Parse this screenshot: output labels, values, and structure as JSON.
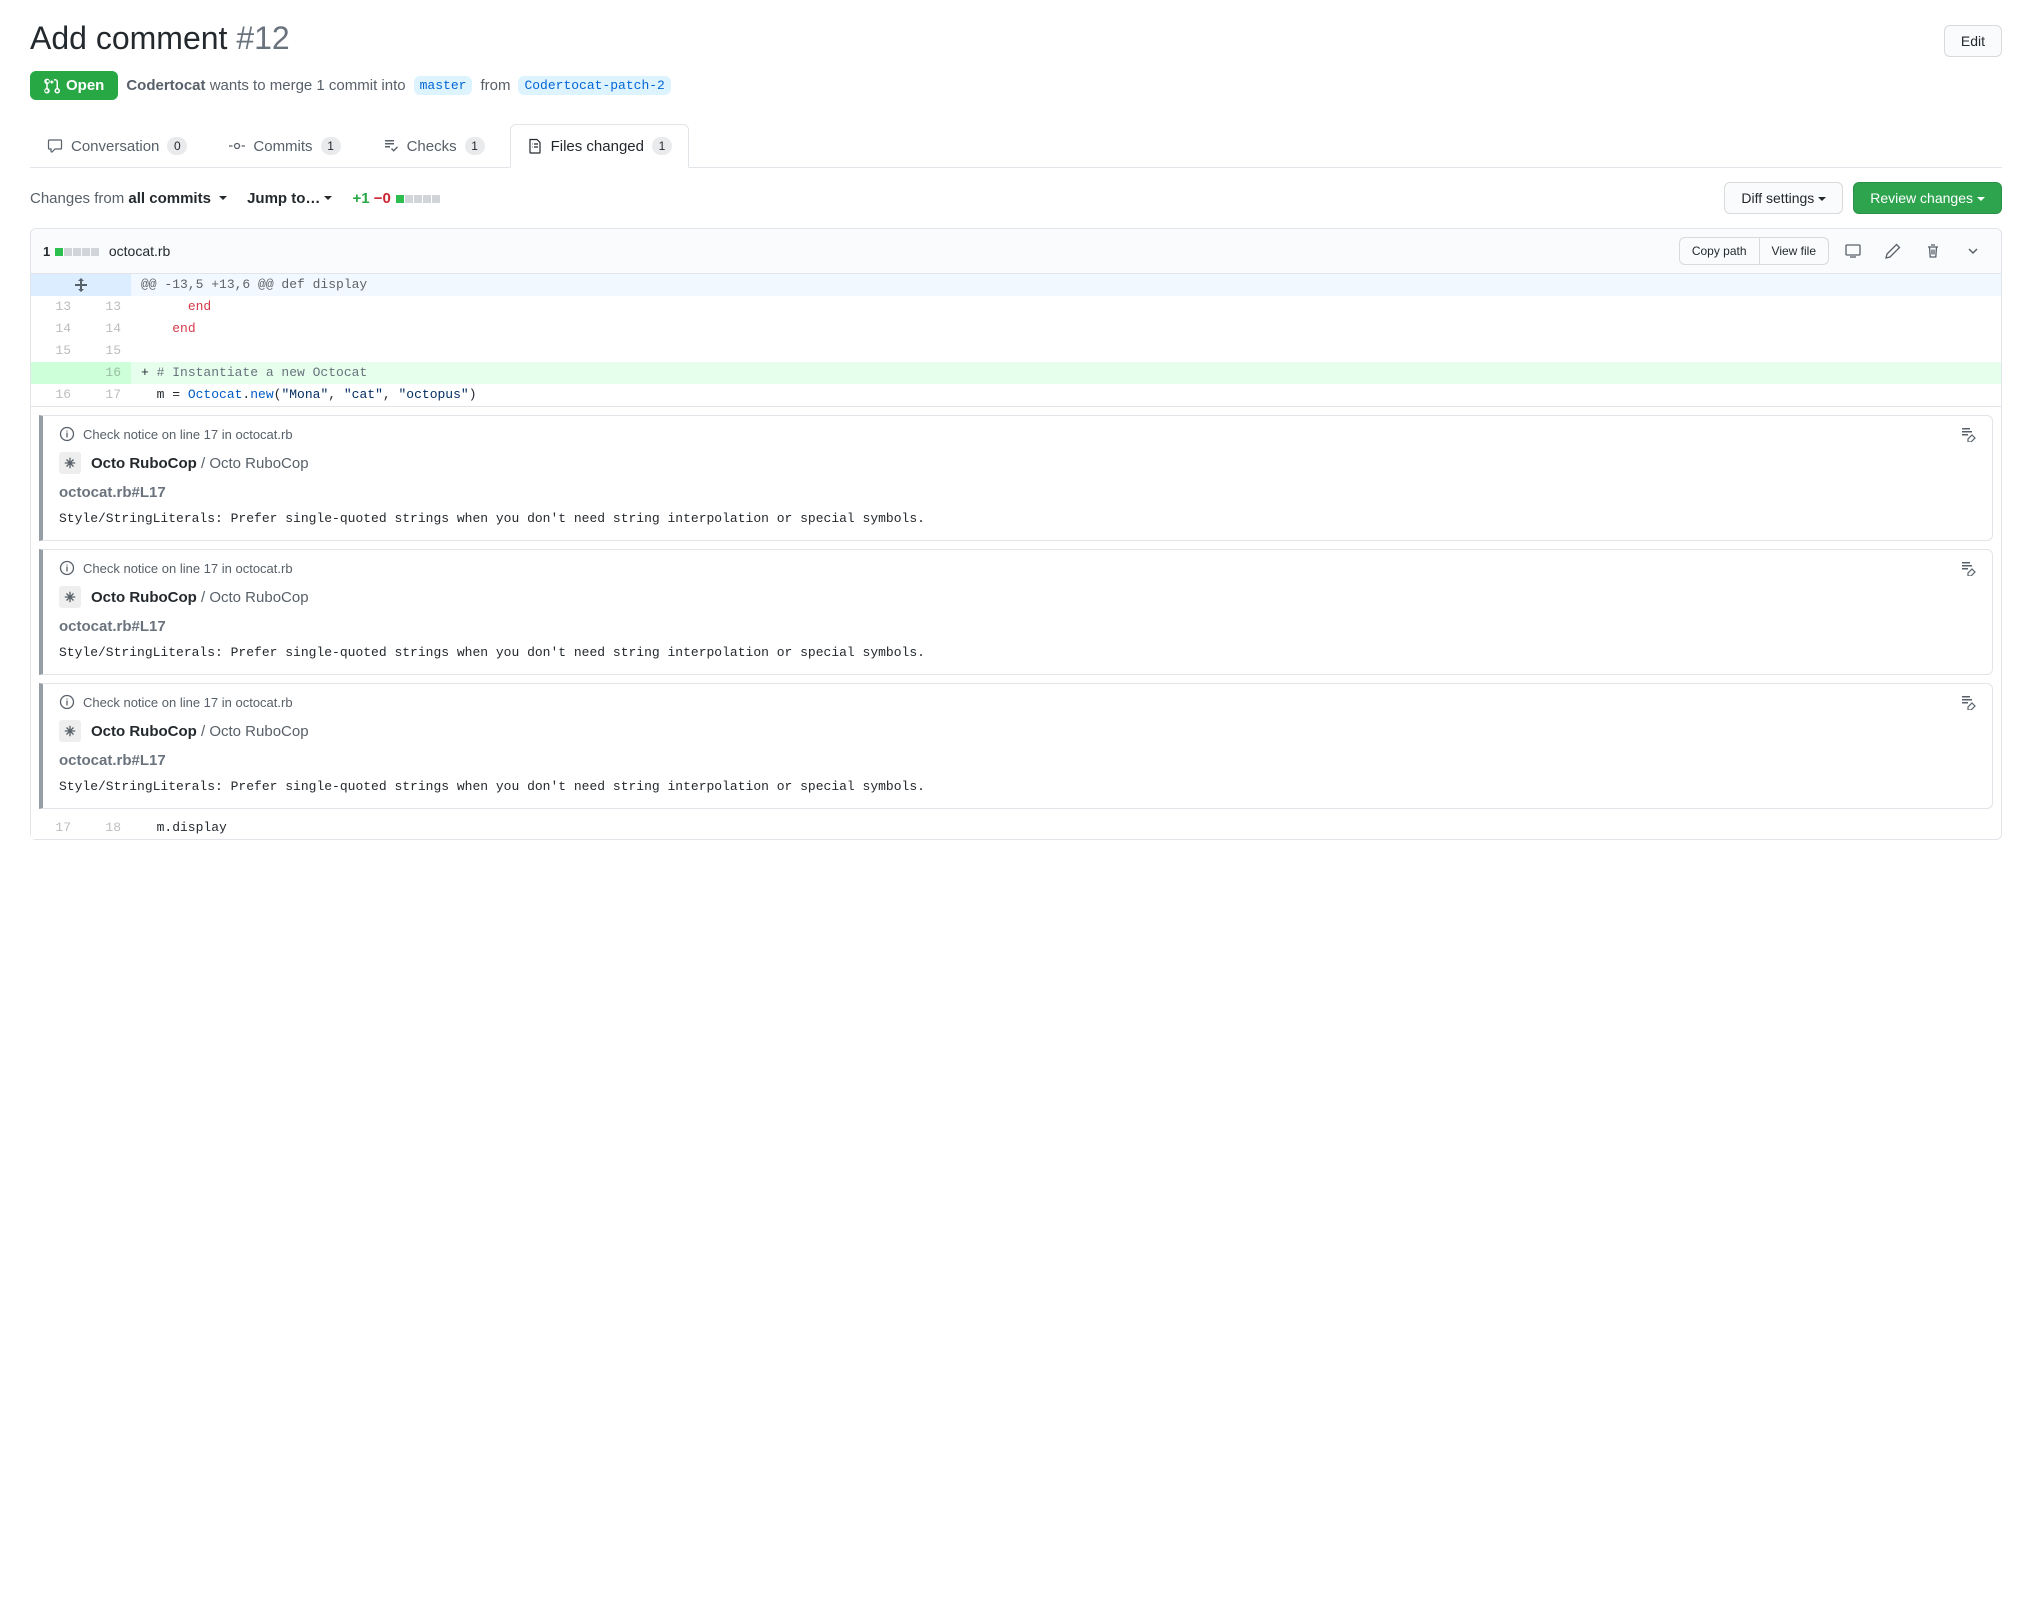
{
  "header": {
    "title": "Add comment",
    "number": "#12",
    "edit_label": "Edit",
    "state": "Open",
    "author": "Codertocat",
    "merge_text": "wants to merge 1 commit into",
    "base_branch": "master",
    "from_text": "from",
    "head_branch": "Codertocat-patch-2"
  },
  "tabs": {
    "conversation": {
      "label": "Conversation",
      "count": "0"
    },
    "commits": {
      "label": "Commits",
      "count": "1"
    },
    "checks": {
      "label": "Checks",
      "count": "1"
    },
    "files": {
      "label": "Files changed",
      "count": "1"
    }
  },
  "toolbar": {
    "changes_from_label": "Changes from",
    "changes_from_value": "all commits",
    "jump_to_label": "Jump to…",
    "additions": "+1",
    "deletions": "−0",
    "diff_settings_label": "Diff settings",
    "review_changes_label": "Review changes"
  },
  "file": {
    "stat_count": "1",
    "name": "octocat.rb",
    "copy_path_label": "Copy path",
    "view_file_label": "View file"
  },
  "diff": {
    "hunk": "@@ -13,5 +13,6 @@ def display",
    "rows": [
      {
        "old": "13",
        "new": "13",
        "type": "ctx",
        "html": "      <span class='kw'>end</span>"
      },
      {
        "old": "14",
        "new": "14",
        "type": "ctx",
        "html": "    <span class='kw'>end</span>"
      },
      {
        "old": "15",
        "new": "15",
        "type": "ctx",
        "html": ""
      },
      {
        "old": "",
        "new": "16",
        "type": "add",
        "html": "+ <span class='cm'># Instantiate a new Octocat</span>"
      },
      {
        "old": "16",
        "new": "17",
        "type": "ctx",
        "html": "  m = <span class='cls'>Octocat</span>.<span class='fn'>new</span>(<span class='str'>\"Mona\"</span>, <span class='str'>\"cat\"</span>, <span class='str'>\"octopus\"</span>)"
      }
    ],
    "trailing": {
      "old": "17",
      "new": "18",
      "html": "  m.display"
    }
  },
  "annotation": {
    "notice_text": "Check notice on line 17 in octocat.rb",
    "app_bold": "Octo RuboCop",
    "app_suffix": " / Octo RuboCop",
    "file_ref": "octocat.rb#L17",
    "message": "Style/StringLiterals: Prefer single-quoted strings when you don't need string interpolation or special symbols."
  }
}
